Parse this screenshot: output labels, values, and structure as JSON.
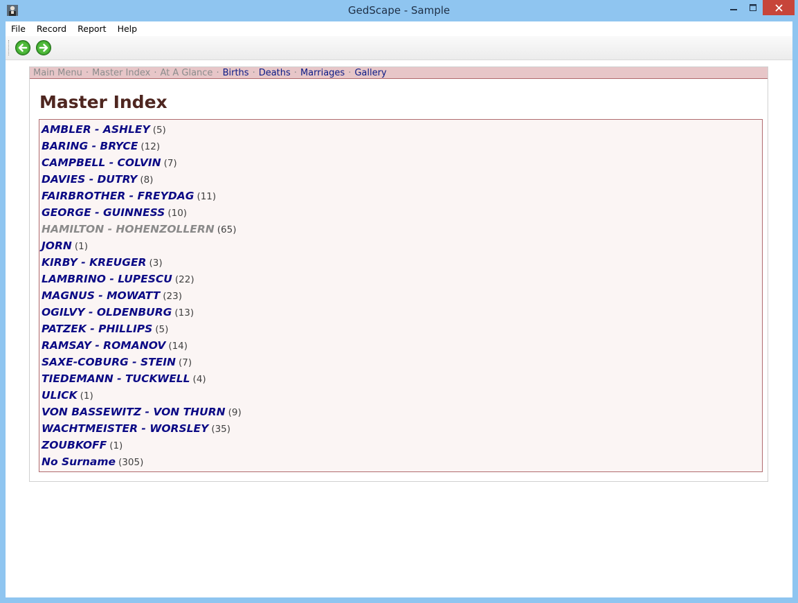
{
  "window": {
    "title": "GedScape - Sample",
    "accent_color": "#8fc5f0",
    "close_color": "#c7453a"
  },
  "menu": {
    "items": [
      "File",
      "Record",
      "Report",
      "Help"
    ]
  },
  "toolbar": {
    "back_icon": "back-arrow-icon",
    "forward_icon": "forward-arrow-icon"
  },
  "nav": {
    "links": [
      {
        "label": "Main Menu",
        "dim": true
      },
      {
        "label": "Master Index",
        "dim": true
      },
      {
        "label": "At A Glance",
        "dim": true
      },
      {
        "label": "Births",
        "dim": false
      },
      {
        "label": "Deaths",
        "dim": false
      },
      {
        "label": "Marriages",
        "dim": false
      },
      {
        "label": "Gallery",
        "dim": false
      }
    ],
    "separator": "·"
  },
  "page": {
    "title": "Master Index"
  },
  "index": {
    "items": [
      {
        "name": "AMBLER - ASHLEY",
        "count": "(5)",
        "visited": false
      },
      {
        "name": "BARING - BRYCE",
        "count": "(12)",
        "visited": false
      },
      {
        "name": "CAMPBELL - COLVIN",
        "count": "(7)",
        "visited": false
      },
      {
        "name": "DAVIES - DUTRY",
        "count": "(8)",
        "visited": false
      },
      {
        "name": "FAIRBROTHER - FREYDAG",
        "count": "(11)",
        "visited": false
      },
      {
        "name": "GEORGE - GUINNESS",
        "count": "(10)",
        "visited": false
      },
      {
        "name": "HAMILTON - HOHENZOLLERN",
        "count": "(65)",
        "visited": true
      },
      {
        "name": "JORN",
        "count": "(1)",
        "visited": false
      },
      {
        "name": "KIRBY - KREUGER",
        "count": "(3)",
        "visited": false
      },
      {
        "name": "LAMBRINO - LUPESCU",
        "count": "(22)",
        "visited": false
      },
      {
        "name": "MAGNUS - MOWATT",
        "count": "(23)",
        "visited": false
      },
      {
        "name": "OGILVY - OLDENBURG",
        "count": "(13)",
        "visited": false
      },
      {
        "name": "PATZEK - PHILLIPS",
        "count": "(5)",
        "visited": false
      },
      {
        "name": "RAMSAY - ROMANOV",
        "count": "(14)",
        "visited": false
      },
      {
        "name": "SAXE-COBURG - STEIN",
        "count": "(7)",
        "visited": false
      },
      {
        "name": "TIEDEMANN - TUCKWELL",
        "count": "(4)",
        "visited": false
      },
      {
        "name": "ULICK",
        "count": "(1)",
        "visited": false
      },
      {
        "name": "VON BASSEWITZ - VON THURN",
        "count": "(9)",
        "visited": false
      },
      {
        "name": "WACHTMEISTER - WORSLEY",
        "count": "(35)",
        "visited": false
      },
      {
        "name": "ZOUBKOFF",
        "count": "(1)",
        "visited": false
      },
      {
        "name": "No Surname",
        "count": "(305)",
        "visited": false
      }
    ]
  }
}
